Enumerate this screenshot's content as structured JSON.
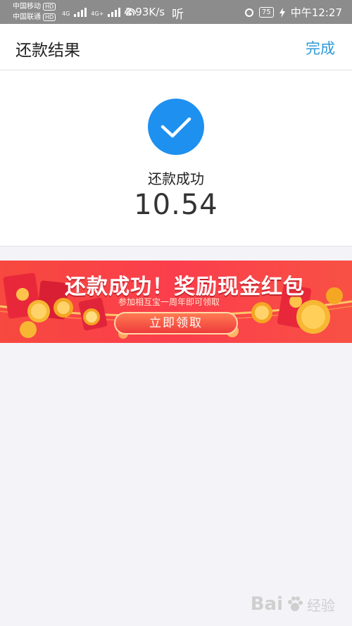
{
  "status_bar": {
    "carrier1": "中国移动",
    "carrier2": "中国联通",
    "hd_label": "HD",
    "net_label1": "4G",
    "net_label2": "4G+",
    "speed": "2.93K/s",
    "ting": "听",
    "battery": "75",
    "time": "中午12:27"
  },
  "header": {
    "title": "还款结果",
    "done_label": "完成"
  },
  "result": {
    "status_text": "还款成功",
    "amount": "10.54",
    "check_color": "#1e90f0"
  },
  "banner": {
    "title": "还款成功！奖励现金红包",
    "subtitle": "参加相互宝一周年即可领取",
    "button_label": "立即领取"
  },
  "watermark": {
    "brand": "Bai",
    "suffix": "经验"
  }
}
